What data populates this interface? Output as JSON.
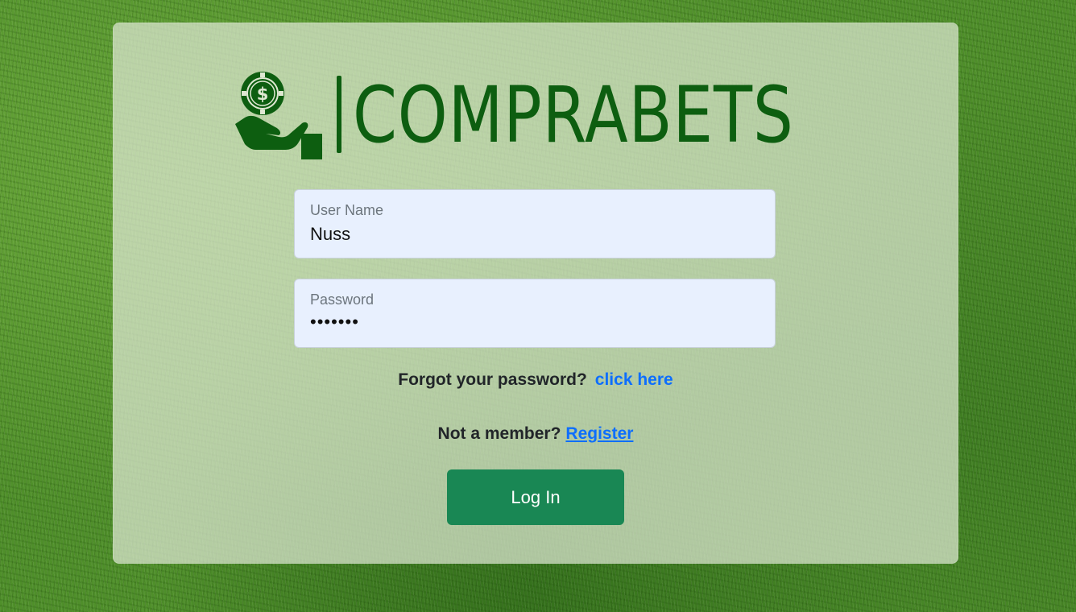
{
  "brand": {
    "name": "COMPRABETS",
    "logo_icon": "hand-holding-casino-chip-dollar-icon",
    "color": "#0d5e10"
  },
  "form": {
    "username": {
      "label": "User Name",
      "value": "Nuss"
    },
    "password": {
      "label": "Password",
      "value": "•••••••"
    },
    "forgot": {
      "text": "Forgot your password?",
      "link": "click here"
    },
    "register": {
      "text": "Not a member?",
      "link": "Register"
    },
    "submit_label": "Log In"
  },
  "colors": {
    "link": "#0d6efd",
    "button": "#198754",
    "input_bg": "#e8f0fe"
  }
}
